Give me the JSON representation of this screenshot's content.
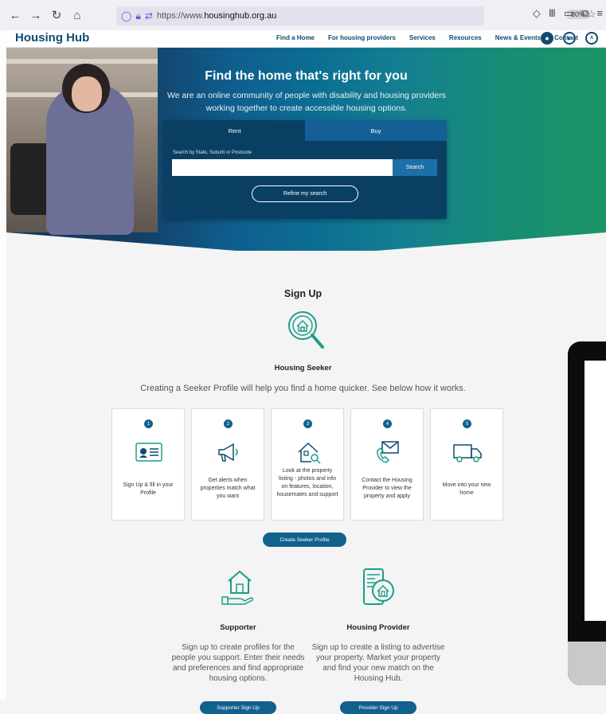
{
  "browser": {
    "url_prefix": "https://www.",
    "url_domain": "housinghub.org.au",
    "zoom": "80%"
  },
  "header": {
    "logo": "Housing Hub",
    "nav": [
      "Find a Home",
      "For housing providers",
      "Services",
      "Resources",
      "News & Events",
      "Contact"
    ]
  },
  "hero": {
    "title": "Find the home that's right for you",
    "subtitle": "We are an online community of people with disability and housing providers working together to create accessible housing options.",
    "tabs": {
      "rent": "Rent",
      "buy": "Buy"
    },
    "search_label": "Search by State, Suburb or Postcode",
    "search_value": "",
    "search_button": "Search",
    "refine_button": "Refine my search"
  },
  "signup": {
    "title": "Sign Up",
    "seeker_title": "Housing Seeker",
    "seeker_desc": "Creating a Seeker Profile will help you find a home quicker. See below how it works.",
    "steps": [
      {
        "num": "1",
        "text": "Sign Up & fill in your Profile"
      },
      {
        "num": "2",
        "text": "Get alerts when properties match what you want"
      },
      {
        "num": "3",
        "text": "Look at the property listing - photos and info on features, location, housemates and support"
      },
      {
        "num": "4",
        "text": "Contact the Housing Provider to view the property and apply"
      },
      {
        "num": "5",
        "text": "Move into your new home"
      }
    ],
    "create_button": "Create Seeker Profile",
    "supporter": {
      "title": "Supporter",
      "desc": "Sign up to create profiles for the people you support. Enter their needs and preferences and find appropriate housing options.",
      "button": "Supporter Sign Up"
    },
    "provider": {
      "title": "Housing Provider",
      "desc": "Sign up to create a listing to advertise your property. Market your property and find your new match on the Housing Hub.",
      "button": "Provider Sign Up"
    }
  },
  "colors": {
    "brand": "#0f4a72",
    "accent": "#11618f",
    "teal": "#1a9e8a"
  }
}
